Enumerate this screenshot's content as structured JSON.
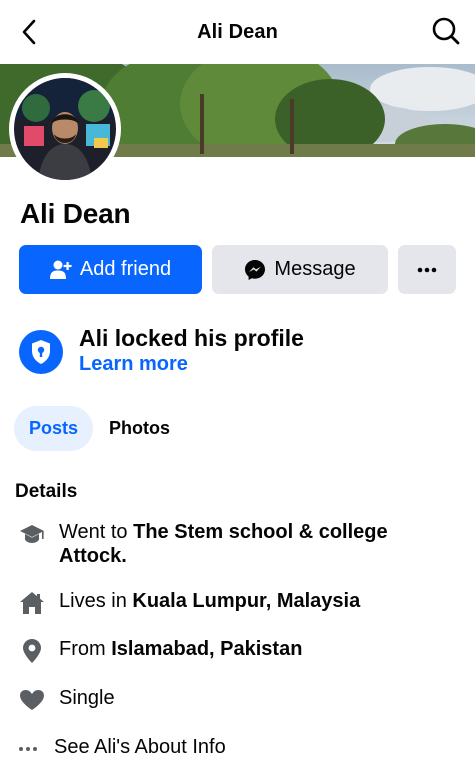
{
  "header": {
    "title": "Ali Dean"
  },
  "profile": {
    "name": "Ali Dean"
  },
  "actions": {
    "add_friend": "Add friend",
    "message": "Message"
  },
  "lock_notice": {
    "title": "Ali locked his profile",
    "link": "Learn more"
  },
  "tabs": [
    {
      "label": "Posts"
    },
    {
      "label": "Photos"
    }
  ],
  "details": {
    "heading": "Details",
    "education_prefix": "Went to ",
    "education_value": "The Stem school & college Attock.",
    "lives_prefix": "Lives in ",
    "lives_value": "Kuala Lumpur, Malaysia",
    "from_prefix": "From ",
    "from_value": "Islamabad, Pakistan",
    "relationship": "Single",
    "about_link": "See Ali's About Info"
  },
  "colors": {
    "accent": "#0866ff",
    "button_gray": "#e4e6eb",
    "tab_active_bg": "#e7f0fe",
    "icon_gray": "#5b5f63"
  }
}
